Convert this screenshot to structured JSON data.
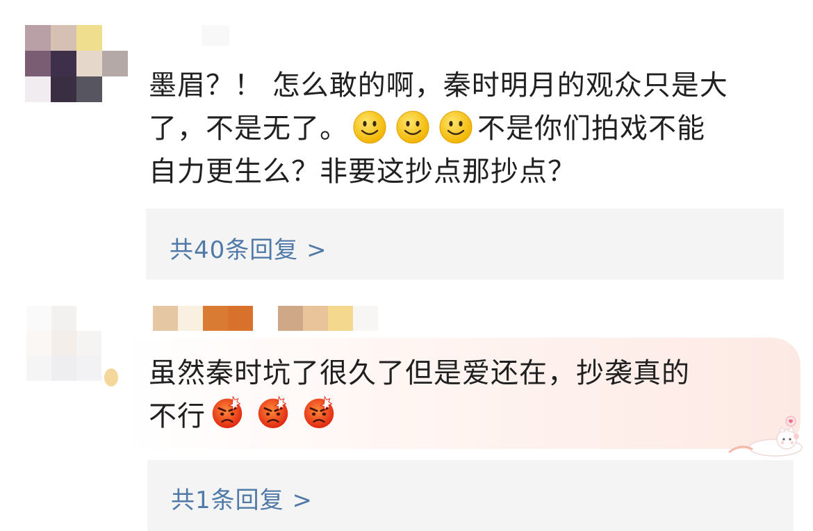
{
  "comments": [
    {
      "line1": "墨眉？！ 怎么敢的啊，秦时明月的观众只是大",
      "line2_before": "了，不是无了。",
      "line2_emojis": [
        "smile-emoji",
        "smile-emoji",
        "smile-emoji"
      ],
      "line2_after": "不是你们拍戏不能",
      "line3": "自力更生么？非要这抄点那抄点？",
      "reply_link": "共40条回复 >"
    },
    {
      "line1": "虽然秦时坑了很久了但是爱还在，抄袭真的",
      "line2_before": "不行",
      "line2_emojis": [
        "angry-emoji",
        "angry-emoji",
        "angry-emoji"
      ],
      "reply_link": "共1条回复 >"
    }
  ],
  "colors": {
    "link": "#4f7aa8",
    "reply_bg": "#f4f4f4",
    "text": "#202020"
  }
}
